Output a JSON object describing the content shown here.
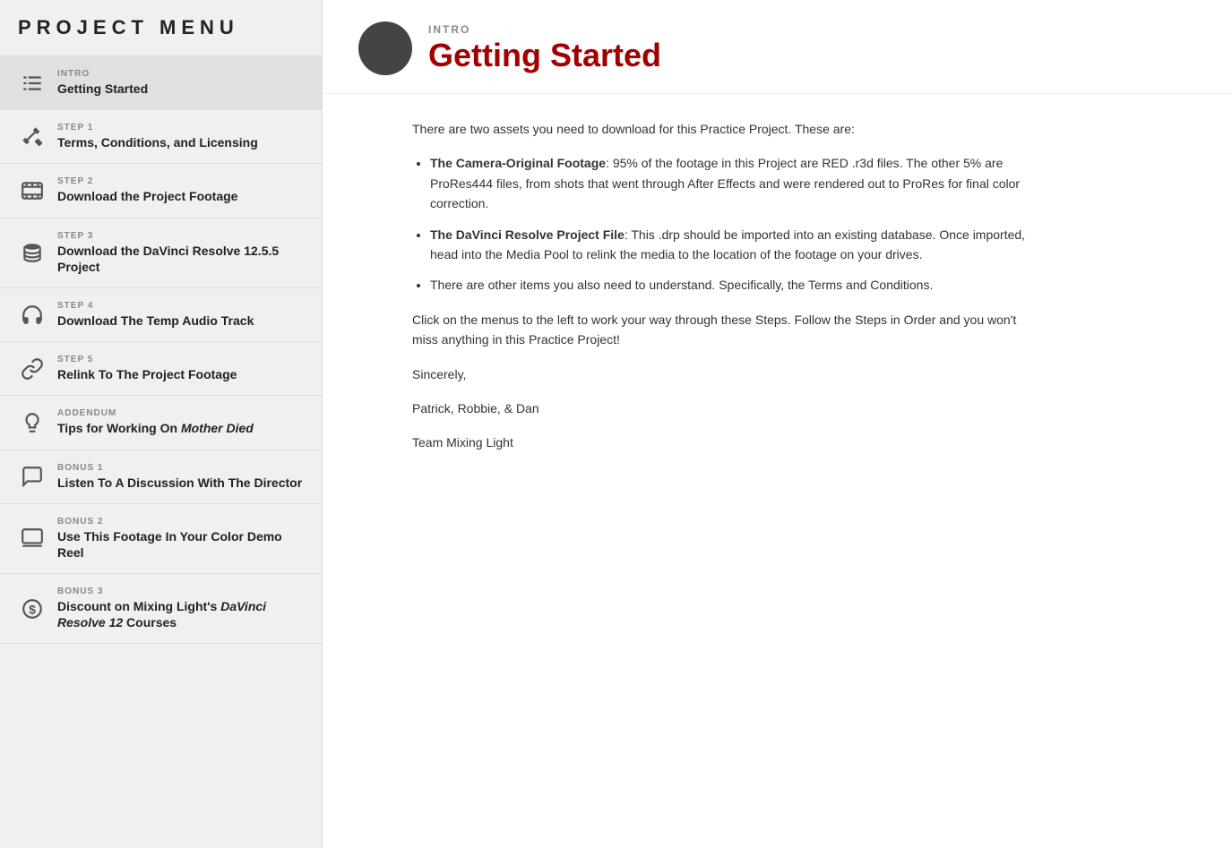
{
  "sidebar": {
    "title": "PROJECT MENU",
    "items": [
      {
        "id": "intro",
        "label": "INTRO",
        "title": "Getting Started",
        "icon": "list-icon",
        "active": true
      },
      {
        "id": "step1",
        "label": "STEP 1",
        "title": "Terms, Conditions, and Licensing",
        "icon": "hammer-icon",
        "active": false
      },
      {
        "id": "step2",
        "label": "STEP 2",
        "title": "Download the Project Footage",
        "icon": "film-icon",
        "active": false
      },
      {
        "id": "step3",
        "label": "STEP 3",
        "title": "Download the DaVinci Resolve 12.5.5 Project",
        "icon": "database-icon",
        "active": false
      },
      {
        "id": "step4",
        "label": "STEP 4",
        "title": "Download The Temp Audio Track",
        "icon": "headphones-icon",
        "active": false
      },
      {
        "id": "step5",
        "label": "STEP 5",
        "title": "Relink To The Project Footage",
        "icon": "link-icon",
        "active": false
      },
      {
        "id": "addendum",
        "label": "ADDENDUM",
        "title_plain": "Tips for Working On ",
        "title_italic": "Mother Died",
        "icon": "bulb-icon",
        "active": false
      },
      {
        "id": "bonus1",
        "label": "BONUS 1",
        "title": "Listen To A Discussion With The Director",
        "icon": "chat-icon",
        "active": false
      },
      {
        "id": "bonus2",
        "label": "BONUS 2",
        "title": "Use This Footage In Your Color Demo Reel",
        "icon": "laptop-icon",
        "active": false
      },
      {
        "id": "bonus3",
        "label": "BONUS 3",
        "title_plain": "Discount on Mixing Light's ",
        "title_italic": "DaVinci Resolve 12",
        "title_end": " Courses",
        "icon": "money-icon",
        "active": false
      }
    ]
  },
  "header": {
    "label": "INTRO",
    "title": "Getting Started"
  },
  "content": {
    "intro": "There are two assets you need to download for this Practice Project. These are:",
    "bullets": [
      {
        "bold": "The Camera-Original Footage",
        "text": ": 95% of the footage in this Project are RED .r3d files. The other 5% are ProRes444 files, from shots that went through After Effects and were rendered out to ProRes for final color correction."
      },
      {
        "bold": "The DaVinci Resolve Project File",
        "text": ": This .drp should be imported into an existing database. Once imported, head into the Media Pool to relink the media to the location of the footage on your drives."
      },
      {
        "bold": "",
        "text": "There are other items you also need to understand. Specifically, the Terms and Conditions."
      }
    ],
    "body": "Click on the menus to the left to work your way through these Steps. Follow the Steps in Order and you won't miss anything in this Practice Project!",
    "sign1": "Sincerely,",
    "sign2": "Patrick, Robbie, & Dan",
    "sign3": "Team Mixing Light"
  }
}
